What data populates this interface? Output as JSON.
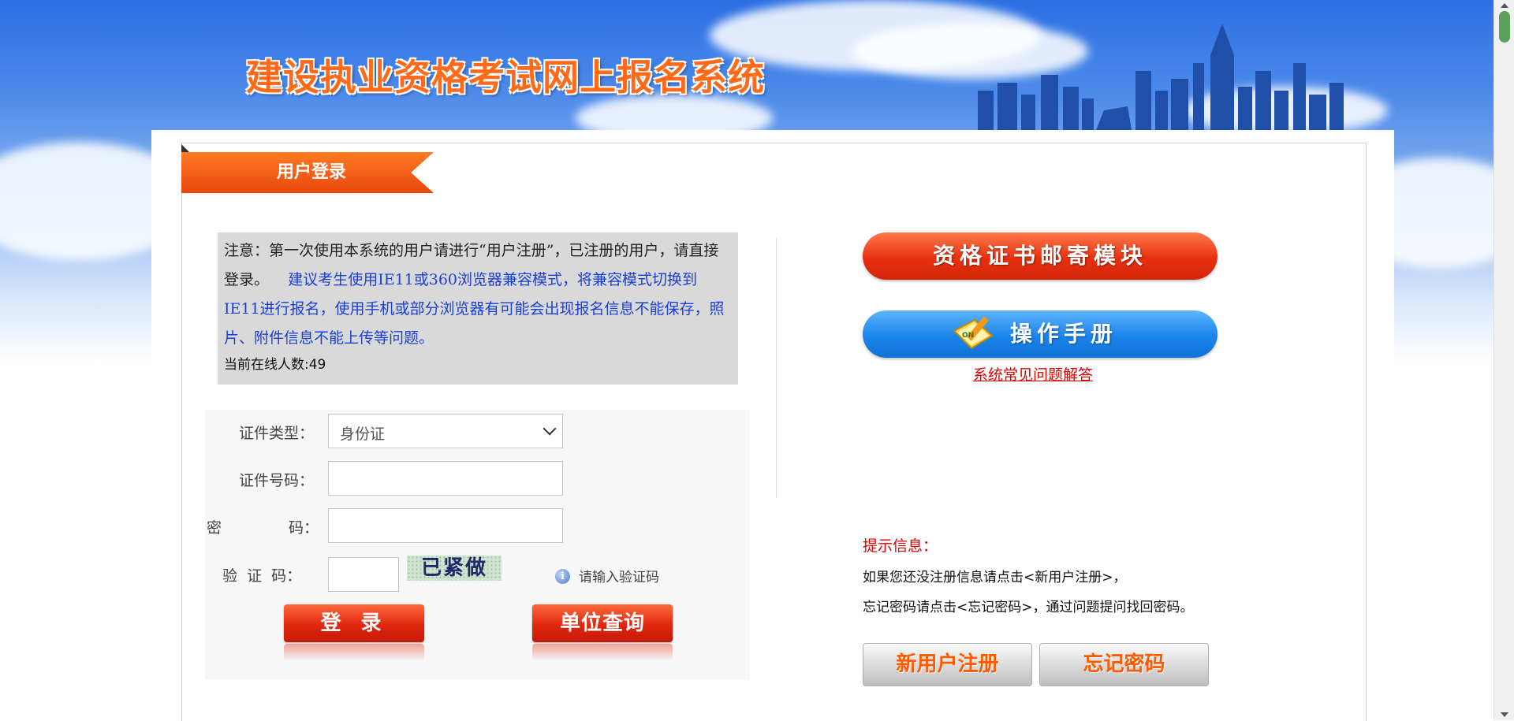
{
  "header": {
    "title": "建设执业资格考试网上报名系统"
  },
  "login_tab": {
    "label": "用户登录"
  },
  "notice": {
    "text_black": "注意：第一次使用本系统的用户请进行“用户注册”，已注册的用户，请直接登录。",
    "text_blue": "建议考生使用IE11或360浏览器兼容模式，将兼容模式切换到IE11进行报名，使用手机或部分浏览器有可能会出现报名信息不能保存，照片、附件信息不能上传等问题。",
    "online_count": "当前在线人数:49"
  },
  "form": {
    "id_type_label": "证件类型：",
    "id_type_value": "身份证",
    "id_number_label": "证件号码：",
    "password_label_1": "密",
    "password_label_2": "码：",
    "captcha_label": "验  证  码：",
    "captcha_image_text": "已紧做",
    "captcha_hint": "请输入验证码",
    "login_button": "登 录",
    "org_query_button": "单位查询"
  },
  "right": {
    "mail_module_button": "资格证书邮寄模块",
    "manual_button": "操作手册",
    "faq_link": "系统常见问题解答",
    "tip_title": "提示信息：",
    "tip_line_1": "如果您还没注册信息请点击<新用户注册>，",
    "tip_line_2": "忘记密码请点击<忘记密码>，通过问题提问找回密码。",
    "register_button": "新用户注册",
    "forgot_button": "忘记密码"
  },
  "colors": {
    "accent_orange": "#e8470e",
    "link_red": "#e00000",
    "notice_blue": "#1a3fd6",
    "sky_blue": "#2b6fe4"
  }
}
